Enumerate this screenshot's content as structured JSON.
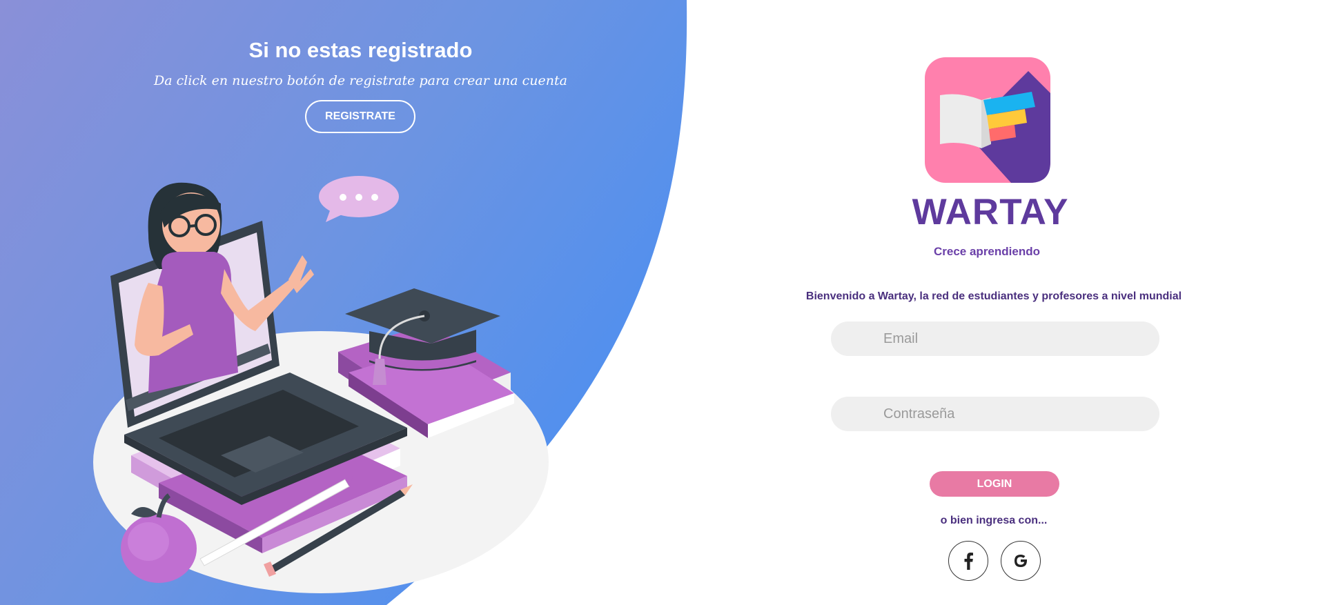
{
  "signup": {
    "title": "Si no estas registrado",
    "text": "Da click en nuestro botón de registrate para crear una cuenta",
    "button_label": "REGISTRATE"
  },
  "brand": {
    "name": "WARTAY",
    "tagline": "Crece aprendiendo",
    "logo_icon": "open-book-icon"
  },
  "login": {
    "welcome": "Bienvenido a Wartay, la red de estudiantes y profesores a nivel mundial",
    "email_placeholder": "Email",
    "password_placeholder": "Contraseña",
    "button_label": "LOGIN",
    "alt_text": "o bien ingresa con..."
  },
  "social": [
    {
      "name": "facebook",
      "icon": "facebook-icon"
    },
    {
      "name": "google",
      "icon": "google-icon"
    }
  ],
  "colors": {
    "gradient_start": "#8a90d8",
    "gradient_end": "#4d8ff0",
    "brand_purple": "#5e3a9d",
    "login_pink": "#e87aa4",
    "logo_pink": "#ff80ad",
    "field_bg": "#efefef"
  }
}
